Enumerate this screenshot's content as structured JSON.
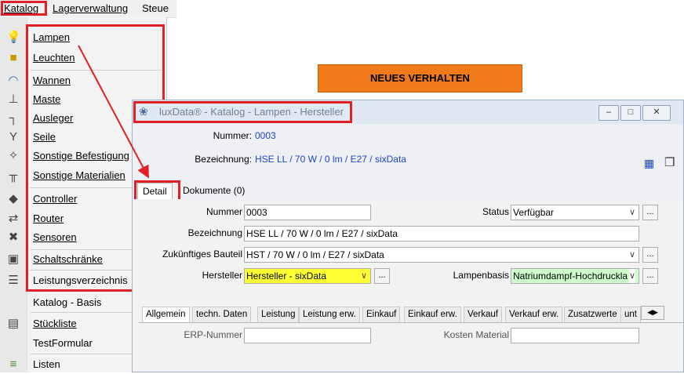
{
  "menubar": {
    "katalog": "Katalog",
    "lagerverwaltung": "Lagerverwaltung",
    "steuer": "Steue"
  },
  "menu": {
    "items": [
      {
        "label": "Lampen",
        "icon": "lamp-icon"
      },
      {
        "label": "Leuchten",
        "icon": "luminaire-icon"
      },
      {
        "label": "Wannen",
        "icon": "tub-icon"
      },
      {
        "label": "Maste",
        "icon": "mast-icon"
      },
      {
        "label": "Ausleger",
        "icon": "boom-icon"
      },
      {
        "label": "Seile",
        "icon": "rope-icon"
      },
      {
        "label": "Sonstige Befestigung",
        "icon": "mount-icon"
      },
      {
        "label": "Sonstige Materialien",
        "icon": "material-icon"
      },
      {
        "label": "Controller",
        "icon": "controller-icon"
      },
      {
        "label": "Router",
        "icon": "router-icon"
      },
      {
        "label": "Sensoren",
        "icon": "sensor-icon"
      },
      {
        "label": "Schaltschränke",
        "icon": "cabinet-icon"
      },
      {
        "label": "Leistungsverzeichnis",
        "icon": "list-icon"
      },
      {
        "label": "Katalog - Basis",
        "icon": ""
      },
      {
        "label": "Stückliste",
        "icon": "parts-icon"
      },
      {
        "label": "TestFormular",
        "icon": ""
      },
      {
        "label": "Listen",
        "icon": "lists-icon"
      }
    ]
  },
  "banner": "NEUES VERHALTEN",
  "window": {
    "title": "luxData® - Katalog - Lampen - Hersteller",
    "header": {
      "nummer_label": "Nummer:",
      "nummer_value": "0003",
      "bezeichnung_label": "Bezeichnung:",
      "bezeichnung_value": "HSE LL / 70 W / 0 lm / E27 / sixData"
    },
    "tabs": [
      "Detail",
      "Dokumente (0)"
    ],
    "form": {
      "nummer_label": "Nummer",
      "nummer_value": "0003",
      "status_label": "Status",
      "status_value": "Verfügbar",
      "bezeichnung_label": "Bezeichnung",
      "bezeichnung_value": "HSE LL / 70 W / 0 lm / E27 / sixData",
      "bauteil_label": "Zukünftiges Bauteil",
      "bauteil_value": "HST / 70 W / 0 lm / E27 / sixData",
      "hersteller_label": "Hersteller",
      "hersteller_value": "Hersteller - sixData",
      "lampenbasis_label": "Lampenbasis",
      "lampenbasis_value": "Natriumdampf-Hochdruckla",
      "ellipsis": "...",
      "erp_label": "ERP-Nummer",
      "kosten_label": "Kosten Material"
    },
    "lower_tabs": [
      "Allgemein",
      "techn. Daten",
      "Leistung",
      "Leistung erw.",
      "Einkauf",
      "Einkauf erw.",
      "Verkauf",
      "Verkauf erw.",
      "Zusatzwerte",
      "unt"
    ]
  },
  "colors": {
    "highlight": "#e01f26",
    "banner": "#f07a19",
    "value_blue": "#1c45c8",
    "hersteller_bg": "#ffff33",
    "lampenbasis_bg": "#ccffcc"
  }
}
